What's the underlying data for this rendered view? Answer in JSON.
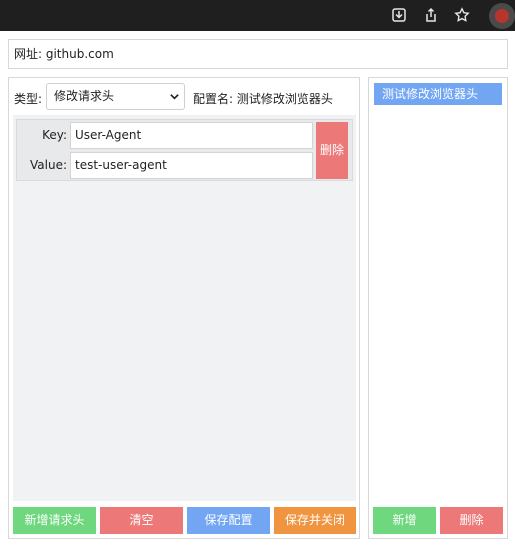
{
  "toolbar": {
    "icons": [
      "download-icon",
      "share-icon",
      "star-icon",
      "extension-icon"
    ],
    "colors": {
      "bg": "#1f1f1f",
      "extension": "#b8352d"
    }
  },
  "url": {
    "text": "网址: github.com"
  },
  "left": {
    "type_label": "类型:",
    "type_select_value": "修改请求头",
    "config_name_text": "配置名: 测试修改浏览器头",
    "headers": [
      {
        "key_label": "Key:",
        "key": "User-Agent",
        "value_label": "Value:",
        "value": "test-user-agent",
        "delete_label": "删除"
      }
    ],
    "buttons": {
      "add_header": "新增请求头",
      "clear": "清空",
      "save_config": "保存配置",
      "save_close": "保存并关闭"
    }
  },
  "right": {
    "configs": [
      "测试修改浏览器头"
    ],
    "buttons": {
      "add": "新增",
      "delete": "删除"
    }
  },
  "colors": {
    "green": "#6fd77e",
    "red": "#ec7878",
    "blue": "#72a6f3",
    "orange": "#f1943f"
  }
}
